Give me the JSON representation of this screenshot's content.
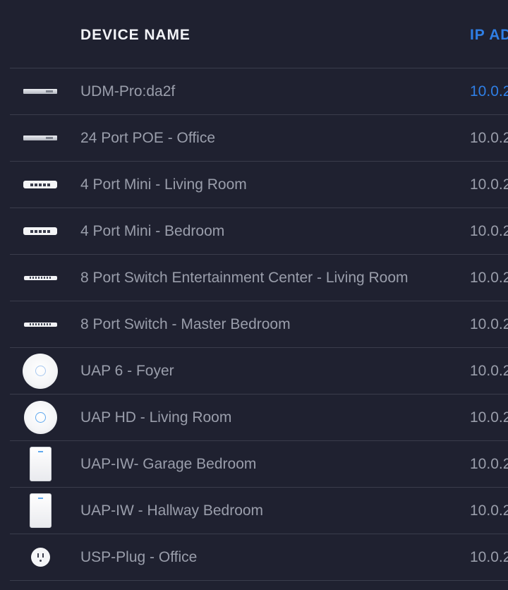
{
  "header": {
    "device_name": "DEVICE NAME",
    "ip_address": "IP AD"
  },
  "colors": {
    "background": "#1f2130",
    "row_text": "#9a9eab",
    "header_text": "#f2f3f7",
    "accent": "#2f7fe6",
    "divider": "#3a3d4c"
  },
  "devices": [
    {
      "name": "UDM-Pro:da2f",
      "ip": "10.0.2",
      "icon": "rack-gateway-icon"
    },
    {
      "name": "24 Port POE - Office",
      "ip": "10.0.2",
      "icon": "rack-switch-icon"
    },
    {
      "name": "4 Port Mini - Living Room",
      "ip": "10.0.2",
      "icon": "mini-switch-icon"
    },
    {
      "name": "4 Port Mini - Bedroom",
      "ip": "10.0.2",
      "icon": "mini-switch-icon"
    },
    {
      "name": "8 Port Switch Entertainment Center - Living Room",
      "ip": "10.0.2",
      "icon": "flat-switch-icon"
    },
    {
      "name": "8 Port Switch - Master Bedroom",
      "ip": "10.0.2",
      "icon": "flat-switch-icon"
    },
    {
      "name": "UAP 6 - Foyer",
      "ip": "10.0.2",
      "icon": "access-point-icon"
    },
    {
      "name": "UAP HD - Living Room",
      "ip": "10.0.2",
      "icon": "access-point-icon"
    },
    {
      "name": "UAP-IW- Garage Bedroom",
      "ip": "10.0.2",
      "icon": "in-wall-ap-icon"
    },
    {
      "name": "UAP-IW - Hallway Bedroom",
      "ip": "10.0.2",
      "icon": "in-wall-ap-icon"
    },
    {
      "name": "USP-Plug - Office",
      "ip": "10.0.2",
      "icon": "smart-plug-icon"
    }
  ]
}
